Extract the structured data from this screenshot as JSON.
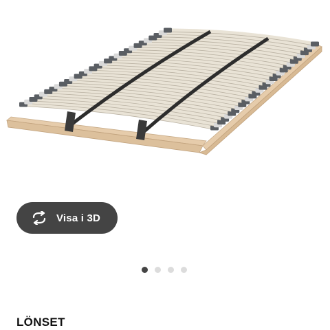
{
  "product": {
    "name": "LÖNSET",
    "image_icon": "slatted-bed-base-image"
  },
  "gallery": {
    "view_3d_label": "Visa i 3D",
    "view_3d_icon": "rotate-arrows-icon",
    "dots_total": 4,
    "active_dot": 1
  },
  "colors": {
    "button_bg": "#444444",
    "dot_active": "#444444",
    "dot_inactive": "#dcdcdc",
    "slat": "#e9e3d6",
    "frame": "#e6ccab",
    "strap": "#2d2d2d"
  }
}
